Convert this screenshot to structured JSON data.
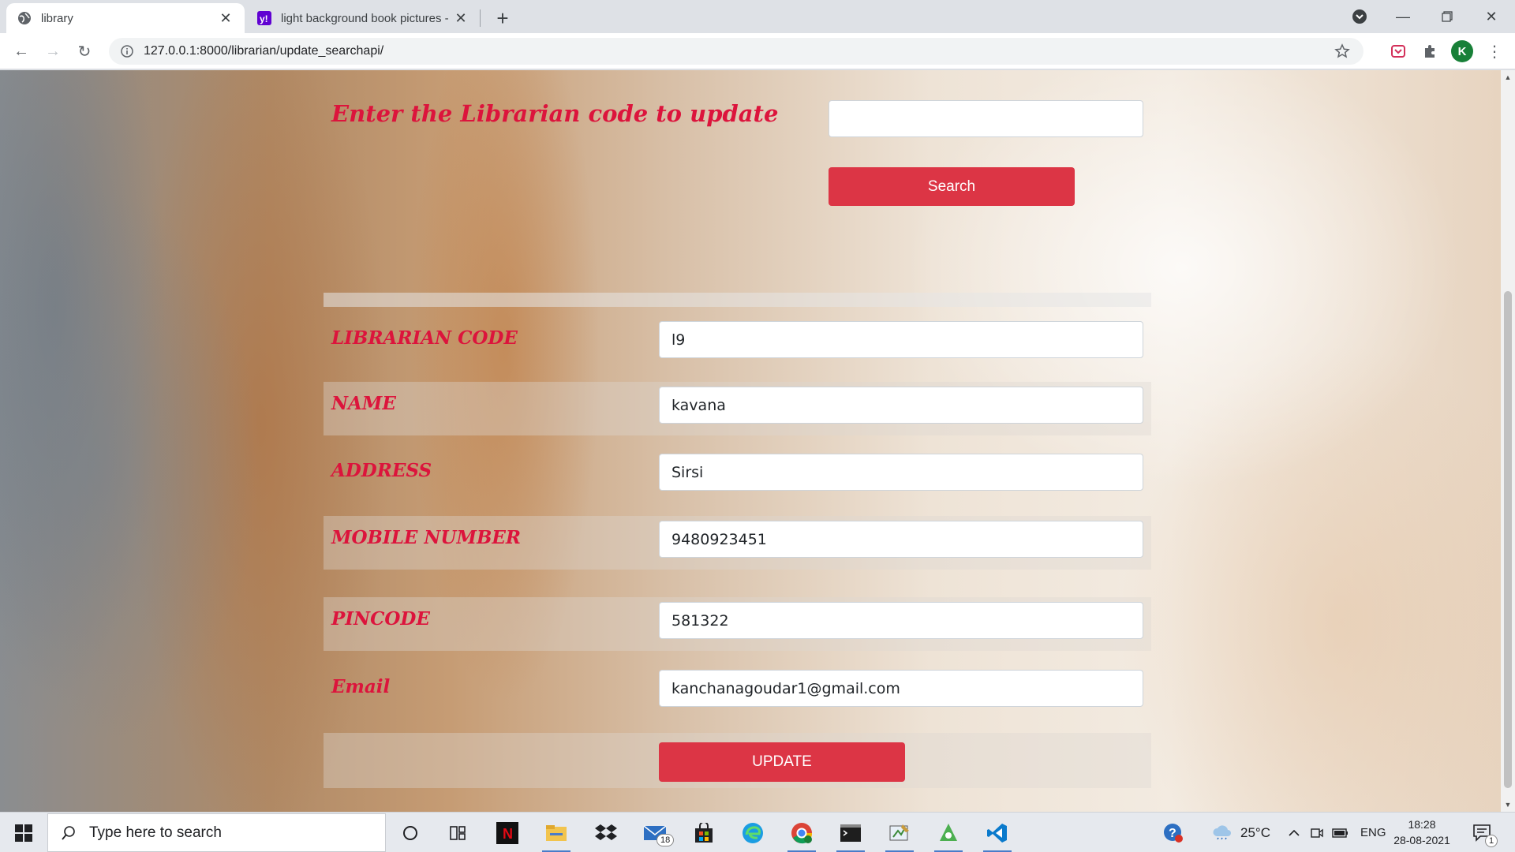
{
  "browser": {
    "tabs": [
      {
        "title": "library",
        "active": true
      },
      {
        "title": "light background book pictures -",
        "active": false
      }
    ],
    "url": "127.0.0.1:8000/librarian/update_searchapi/",
    "profile_initial": "K"
  },
  "search": {
    "prompt": "Enter the Librarian code to update",
    "input_value": "",
    "button_label": "Search"
  },
  "form": {
    "fields": [
      {
        "label": "LIBRARIAN CODE",
        "value": "l9"
      },
      {
        "label": "NAME",
        "value": "kavana"
      },
      {
        "label": "ADDRESS",
        "value": "Sirsi"
      },
      {
        "label": "MOBILE NUMBER",
        "value": "9480923451"
      },
      {
        "label": "PINCODE",
        "value": "581322"
      },
      {
        "label": "Email",
        "value": "kanchanagoudar1@gmail.com"
      }
    ],
    "update_label": "UPDATE"
  },
  "taskbar": {
    "search_placeholder": "Type here to search",
    "mail_badge": "18",
    "weather": "25°C",
    "language": "ENG",
    "time": "18:28",
    "date": "28-08-2021",
    "notification_count": "1"
  },
  "colors": {
    "accent_red": "#dc3545",
    "label_crimson": "#dc143c"
  }
}
